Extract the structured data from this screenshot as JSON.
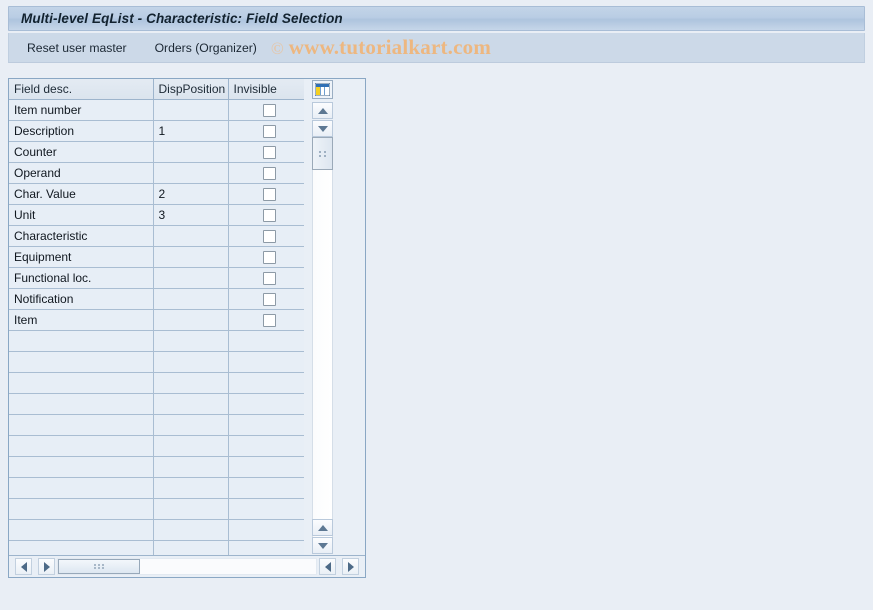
{
  "window": {
    "title": "Multi-level EqList - Characteristic: Field Selection"
  },
  "toolbar": {
    "buttons": [
      {
        "label": "Reset user master",
        "name": "reset-user-master-button"
      },
      {
        "label": "Orders (Organizer)",
        "name": "orders-organizer-button"
      }
    ],
    "watermark_symbol": "©",
    "watermark_text": "www.tutorialkart.com"
  },
  "table": {
    "settings_icon": "table-settings-icon",
    "columns": [
      {
        "key": "field_desc",
        "label": "Field desc."
      },
      {
        "key": "disp_position",
        "label": "DispPosition"
      },
      {
        "key": "invisible",
        "label": "Invisible"
      }
    ],
    "rows": [
      {
        "field_desc": "Item number",
        "disp_position": "",
        "invisible": false
      },
      {
        "field_desc": "Description",
        "disp_position": "1",
        "invisible": false
      },
      {
        "field_desc": "Counter",
        "disp_position": "",
        "invisible": false
      },
      {
        "field_desc": "Operand",
        "disp_position": "",
        "invisible": false
      },
      {
        "field_desc": "Char. Value",
        "disp_position": "2",
        "invisible": false
      },
      {
        "field_desc": "Unit",
        "disp_position": "3",
        "invisible": false
      },
      {
        "field_desc": "Characteristic",
        "disp_position": "",
        "invisible": false
      },
      {
        "field_desc": "Equipment",
        "disp_position": "",
        "invisible": false
      },
      {
        "field_desc": "Functional loc.",
        "disp_position": "",
        "invisible": false
      },
      {
        "field_desc": "Notification",
        "disp_position": "",
        "invisible": false
      },
      {
        "field_desc": "Item",
        "disp_position": "",
        "invisible": false
      }
    ],
    "empty_row_count": 11
  },
  "scrollbars": {
    "vertical": {
      "up_icon": "scroll-up-icon",
      "down_icon": "scroll-down-icon",
      "page_up_icon": "page-up-icon",
      "page_down_icon": "page-down-icon",
      "thumb": "vertical-scroll-thumb"
    },
    "horizontal": {
      "left_icon": "scroll-left-icon",
      "right_icon": "scroll-right-icon",
      "thumb": "horizontal-scroll-thumb"
    }
  },
  "colors": {
    "title_bar": "#b9cde4",
    "toolbar": "#ccd9e8",
    "page_background": "#e9eef5",
    "grid_row": "#e7eef6",
    "input_cell": "#ffffff",
    "watermark": "#edb780",
    "border": "#8aa7c4"
  }
}
